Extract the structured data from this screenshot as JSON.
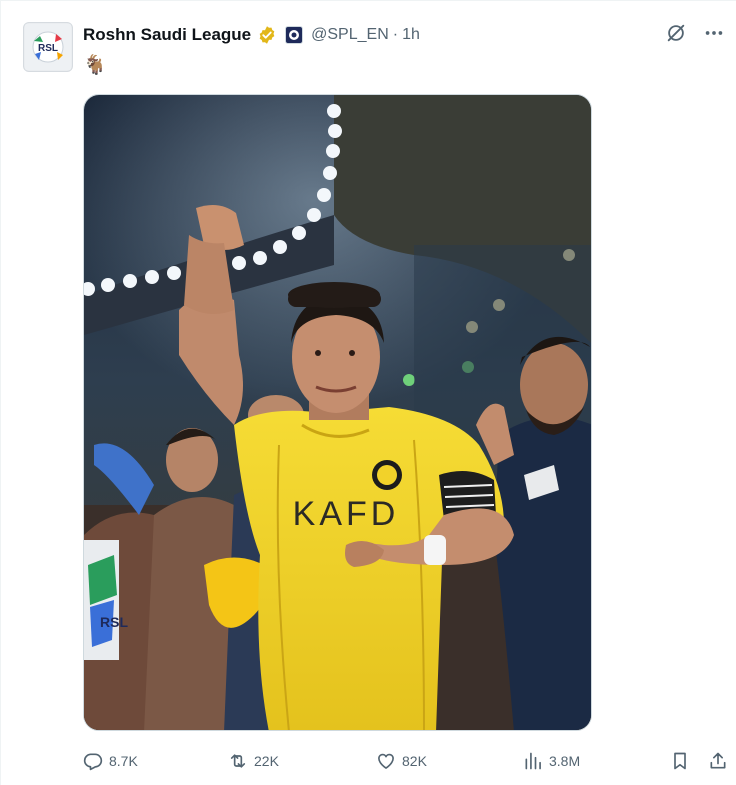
{
  "account": {
    "display_name": "Roshn Saudi League",
    "handle": "@SPL_EN",
    "separator": "·",
    "time": "1h",
    "avatar_text": "RSL"
  },
  "tweet": {
    "text": "🐐"
  },
  "media": {
    "jersey_text": "KAFD",
    "logo_text": "RSL",
    "icon": "photo"
  },
  "actions": {
    "replies": "8.7K",
    "reposts": "22K",
    "likes": "82K",
    "views": "3.8M"
  },
  "icons": {
    "verified": "gold-verified-badge-icon",
    "affiliate": "affiliate-badge-icon",
    "grok": "grok-icon",
    "more": "more-icon",
    "reply": "reply-icon",
    "repost": "repost-icon",
    "like": "heart-icon",
    "views": "views-icon",
    "bookmark": "bookmark-icon",
    "share": "share-icon"
  },
  "colors": {
    "text_primary": "#0f1419",
    "text_secondary": "#536471",
    "verified_gold": "#e2b719",
    "jersey_yellow": "#f2d22a",
    "border": "#cfd9de"
  }
}
